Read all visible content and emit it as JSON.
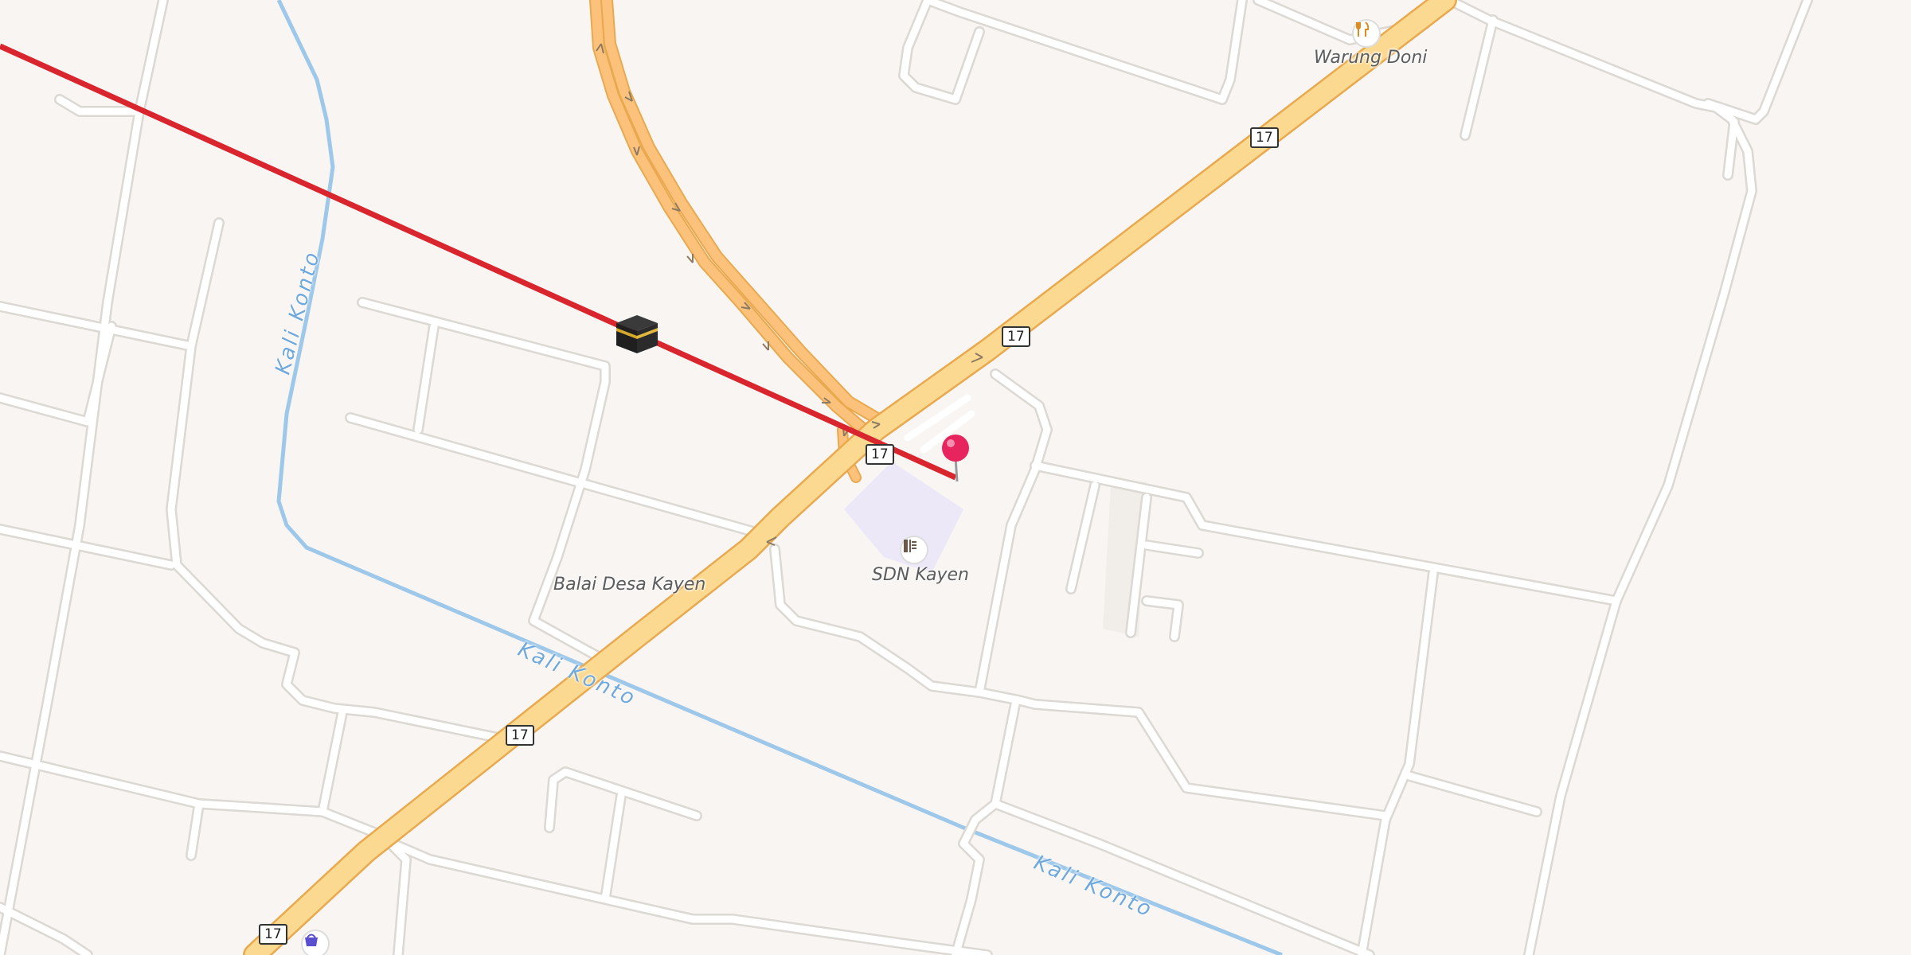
{
  "route_number": "17",
  "labels": {
    "warung": "Warung Doni",
    "school": "SDN Kayen",
    "village_hall": "Balai Desa Kayen",
    "river": "Kali Konto"
  },
  "icons": {
    "restaurant": "fork-knife-icon",
    "school": "school-icon",
    "kaaba": "kaaba-icon",
    "pin": "location-pin-icon",
    "shop": "shopping-basket-icon"
  },
  "colors": {
    "background": "#f8f5f2",
    "minor_road": "#ffffff",
    "primary_road": "#fbd990",
    "primary_road_casing": "#e8a94f",
    "ramp_road": "#fcc27c",
    "river": "#9ec8ea",
    "qibla_line": "#d9262e",
    "pin": "#e8245e",
    "school_area": "#ece8f8"
  }
}
